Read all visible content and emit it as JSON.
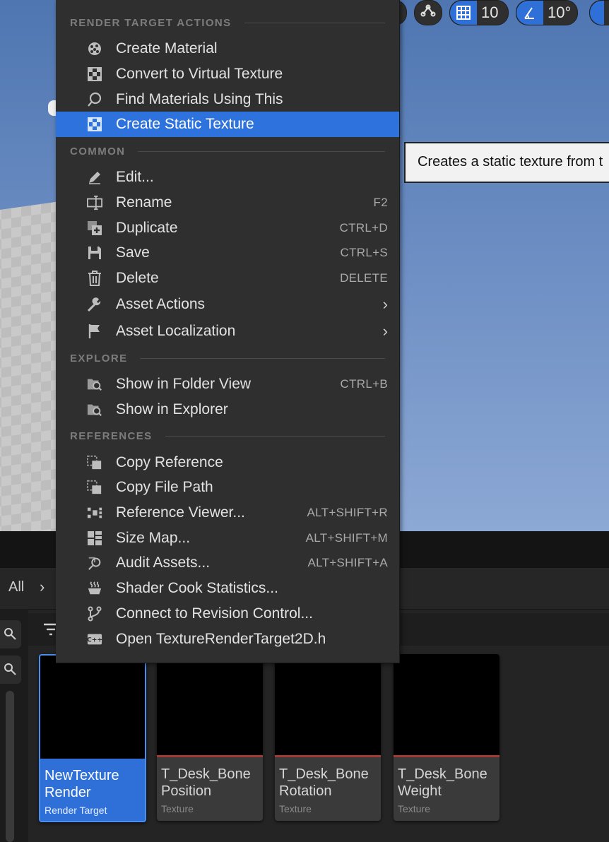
{
  "viewport": {
    "toolbar": {
      "grid_snap_value": "10",
      "angle_snap_value": "10°"
    }
  },
  "menu": {
    "sections": {
      "render_target_actions": "RENDER TARGET ACTIONS",
      "common": "COMMON",
      "explore": "EXPLORE",
      "references": "REFERENCES"
    },
    "items": {
      "create_material": {
        "label": "Create Material",
        "icon": "material-sphere-icon"
      },
      "convert_virtual_texture": {
        "label": "Convert to Virtual Texture",
        "icon": "checker-texture-icon"
      },
      "find_materials": {
        "label": "Find Materials Using This",
        "icon": "magnifier-icon"
      },
      "create_static_texture": {
        "label": "Create Static Texture",
        "icon": "checker-texture-icon",
        "highlighted": true
      },
      "edit": {
        "label": "Edit...",
        "icon": "pencil-icon"
      },
      "rename": {
        "label": "Rename",
        "shortcut": "F2",
        "icon": "rename-cursor-icon"
      },
      "duplicate": {
        "label": "Duplicate",
        "shortcut": "CTRL+D",
        "icon": "duplicate-icon"
      },
      "save": {
        "label": "Save",
        "shortcut": "CTRL+S",
        "icon": "floppy-disk-icon"
      },
      "delete": {
        "label": "Delete",
        "shortcut": "DELETE",
        "icon": "trash-icon"
      },
      "asset_actions": {
        "label": "Asset Actions",
        "icon": "wrench-icon"
      },
      "asset_localization": {
        "label": "Asset Localization",
        "icon": "flag-icon"
      },
      "show_folder_view": {
        "label": "Show in Folder View",
        "shortcut": "CTRL+B",
        "icon": "folder-search-icon"
      },
      "show_explorer": {
        "label": "Show in Explorer",
        "icon": "folder-search-icon"
      },
      "copy_reference": {
        "label": "Copy Reference",
        "icon": "copy-reference-icon"
      },
      "copy_file_path": {
        "label": "Copy File Path",
        "icon": "copy-path-icon"
      },
      "reference_viewer": {
        "label": "Reference Viewer...",
        "shortcut": "ALT+SHIFT+R",
        "icon": "reference-graph-icon"
      },
      "size_map": {
        "label": "Size Map...",
        "shortcut": "ALT+SHIFT+M",
        "icon": "size-map-icon"
      },
      "audit_assets": {
        "label": "Audit Assets...",
        "shortcut": "ALT+SHIFT+A",
        "icon": "audit-magnifier-icon"
      },
      "shader_cook": {
        "label": "Shader Cook Statistics...",
        "icon": "steaming-cup-icon"
      },
      "connect_revision": {
        "label": "Connect to Revision Control...",
        "icon": "branch-icon"
      },
      "open_header": {
        "label": "Open TextureRenderTarget2D.h",
        "icon": "cpp-file-icon"
      }
    }
  },
  "tooltip": {
    "text": "Creates a static texture from t"
  },
  "content_browser": {
    "breadcrumb_all": "All",
    "assets": [
      {
        "name_line1": "NewTexture",
        "name_line2": "Render",
        "type": "Render Target",
        "selected": true
      },
      {
        "name_line1": "T_Desk_Bone",
        "name_line2": "Position",
        "type": "Texture",
        "selected": false
      },
      {
        "name_line1": "T_Desk_Bone",
        "name_line2": "Rotation",
        "type": "Texture",
        "selected": false
      },
      {
        "name_line1": "T_Desk_Bone",
        "name_line2": "Weight",
        "type": "Texture",
        "selected": false
      }
    ]
  },
  "colors": {
    "accent": "#2e72dd",
    "menu_bg": "#2f2f2f",
    "viewport_sky": "#5f82bb"
  }
}
